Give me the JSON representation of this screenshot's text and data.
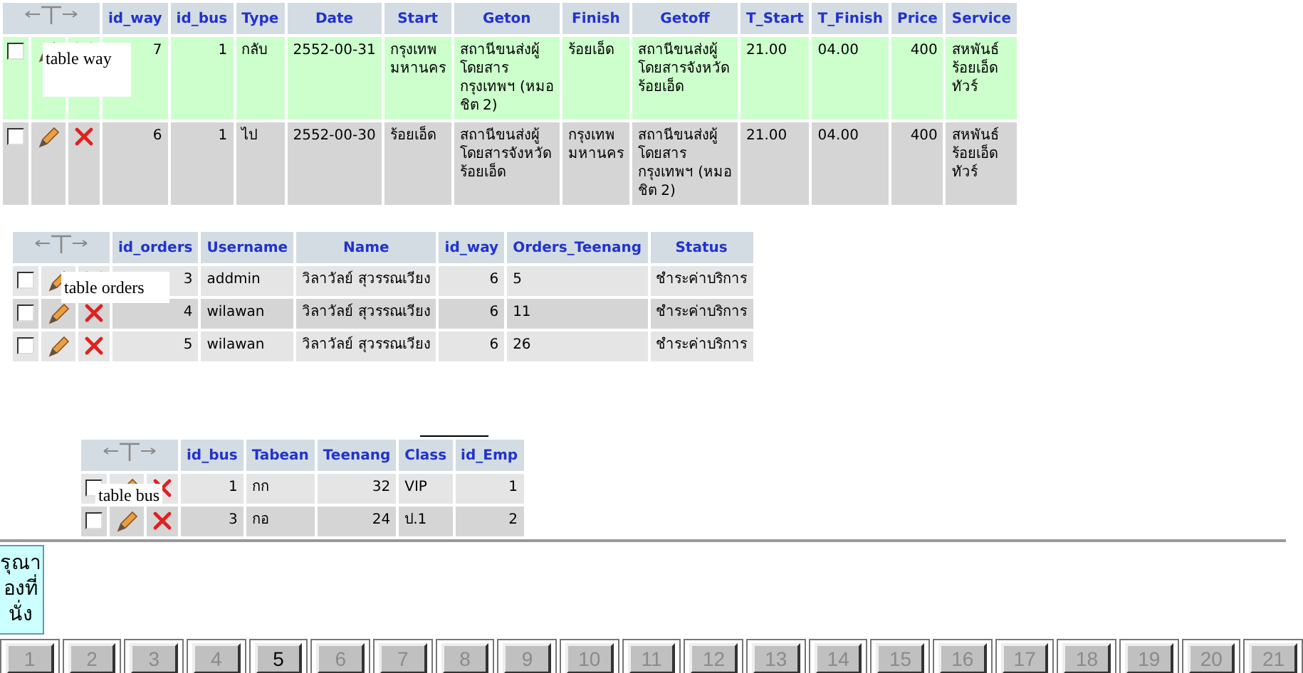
{
  "tables": [
    {
      "note": "table way",
      "columns": [
        {
          "label": "id_way",
          "numeric": true
        },
        {
          "label": "id_bus",
          "numeric": true
        },
        {
          "label": "Type"
        },
        {
          "label": "Date"
        },
        {
          "label": "Start"
        },
        {
          "label": "Geton"
        },
        {
          "label": "Finish"
        },
        {
          "label": "Getoff"
        },
        {
          "label": "T_Start"
        },
        {
          "label": "T_Finish"
        },
        {
          "label": "Price",
          "numeric": true
        },
        {
          "label": "Service"
        }
      ],
      "rows": [
        {
          "marked": true,
          "checked": false,
          "cells": [
            "7",
            "1",
            "กลับ",
            "2552-00-31",
            "กรุงเทพ\nมหานคร",
            "สถานีขนส่งผู้\nโดยสาร\nกรุงเทพฯ (หมอ\nชิต 2)",
            "ร้อยเอ็ด",
            "สถานีขนส่งผู้\nโดยสารจังหวัด\nร้อยเอ็ด",
            "21.00",
            "04.00",
            "400",
            "สหพันธ์\nร้อยเอ็ด\nทัวร์"
          ]
        },
        {
          "marked": false,
          "checked": false,
          "cells": [
            "6",
            "1",
            "ไป",
            "2552-00-30",
            "ร้อยเอ็ด",
            "สถานีขนส่งผู้\nโดยสารจังหวัด\nร้อยเอ็ด",
            "กรุงเทพ\nมหานคร",
            "สถานีขนส่งผู้\nโดยสาร\nกรุงเทพฯ (หมอ\nชิต 2)",
            "21.00",
            "04.00",
            "400",
            "สหพันธ์\nร้อยเอ็ด\nทัวร์"
          ]
        }
      ]
    },
    {
      "note": "table orders",
      "columns": [
        {
          "label": "id_orders",
          "numeric": true
        },
        {
          "label": "Username"
        },
        {
          "label": "Name"
        },
        {
          "label": "id_way",
          "numeric": true
        },
        {
          "label": "Orders_Teenang"
        },
        {
          "label": "Status"
        }
      ],
      "rows": [
        {
          "marked": false,
          "checked": false,
          "cells": [
            "3",
            "addmin",
            "วิลาวัลย์ สุวรรณเวียง",
            "6",
            "5",
            "ชำระค่าบริการ"
          ]
        },
        {
          "marked": false,
          "checked": false,
          "cells": [
            "4",
            "wilawan",
            "วิลาวัลย์ สุวรรณเวียง",
            "6",
            "11",
            "ชำระค่าบริการ"
          ]
        },
        {
          "marked": false,
          "checked": false,
          "cells": [
            "5",
            "wilawan",
            "วิลาวัลย์ สุวรรณเวียง",
            "6",
            "26",
            "ชำระค่าบริการ"
          ]
        }
      ]
    },
    {
      "note": "table bus",
      "columns": [
        {
          "label": "id_bus",
          "numeric": true
        },
        {
          "label": "Tabean"
        },
        {
          "label": "Teenang",
          "numeric": true
        },
        {
          "label": "Class"
        },
        {
          "label": "id_Emp",
          "numeric": true
        }
      ],
      "rows": [
        {
          "marked": false,
          "checked": false,
          "cells": [
            "1",
            "กก",
            "32",
            "VIP",
            "1"
          ]
        },
        {
          "marked": false,
          "checked": false,
          "cells": [
            "3",
            "กอ",
            "24",
            "ป.1",
            "2"
          ]
        }
      ]
    }
  ],
  "notice": {
    "lines": [
      "รุณา",
      "องที่",
      "นั่ง"
    ]
  },
  "seats": [
    {
      "label": "1",
      "disabled": true
    },
    {
      "label": "2",
      "disabled": true
    },
    {
      "label": "3",
      "disabled": true
    },
    {
      "label": "4",
      "disabled": true
    },
    {
      "label": "5",
      "disabled": false
    },
    {
      "label": "6",
      "disabled": true
    },
    {
      "label": "7",
      "disabled": true
    },
    {
      "label": "8",
      "disabled": true
    },
    {
      "label": "9",
      "disabled": true
    },
    {
      "label": "10",
      "disabled": true
    },
    {
      "label": "11",
      "disabled": true
    },
    {
      "label": "12",
      "disabled": true
    },
    {
      "label": "13",
      "disabled": true
    },
    {
      "label": "14",
      "disabled": true
    },
    {
      "label": "15",
      "disabled": true
    },
    {
      "label": "16",
      "disabled": true
    },
    {
      "label": "17",
      "disabled": true
    },
    {
      "label": "18",
      "disabled": true
    },
    {
      "label": "19",
      "disabled": true
    },
    {
      "label": "20",
      "disabled": true
    },
    {
      "label": "21",
      "disabled": true
    }
  ]
}
